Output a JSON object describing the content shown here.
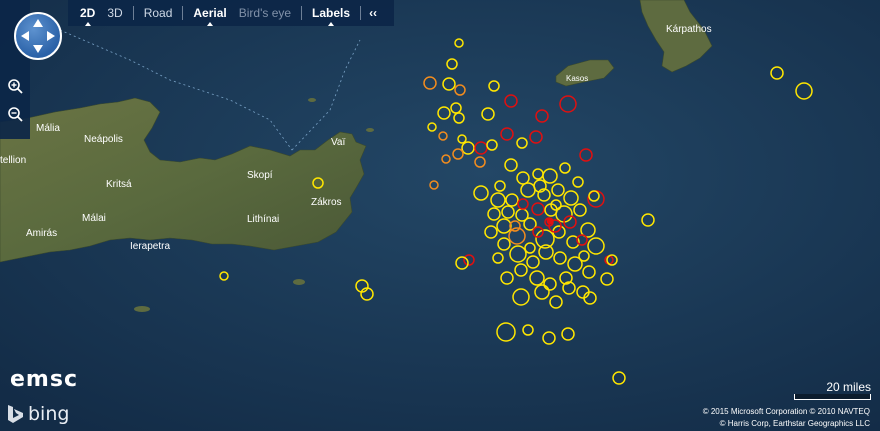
{
  "toolbar": {
    "mode_2d": "2D",
    "mode_3d": "3D",
    "road": "Road",
    "aerial": "Aerial",
    "birds_eye": "Bird's eye",
    "labels": "Labels",
    "collapse": "‹‹"
  },
  "branding": {
    "emsc": "emsc",
    "bing": "bing"
  },
  "scale": {
    "label": "20 miles"
  },
  "copyright": {
    "line1": "© 2015 Microsoft Corporation   © 2010 NAVTEQ",
    "line2": "© Harris Corp, Earthstar Geographics LLC"
  },
  "place_labels": [
    "Kárpathos",
    "Kasos",
    "Mália",
    "Neápolis",
    "Vaï",
    "tellion",
    "Kritsá",
    "Skopí",
    "Zákros",
    "Málai",
    "Lithínai",
    "Amirás",
    "Ierapetra"
  ],
  "icons": [
    "pan-arrows-icon",
    "zoom-in-icon",
    "zoom-out-icon",
    "bing-logo-icon"
  ],
  "colors": {
    "sea": "#1b3b59",
    "land": "#5b6a3c",
    "marker_yellow": "#ffe600",
    "marker_orange": "#f28c1e",
    "marker_red": "#e01010",
    "toolbar_bg": "#0c2648"
  }
}
